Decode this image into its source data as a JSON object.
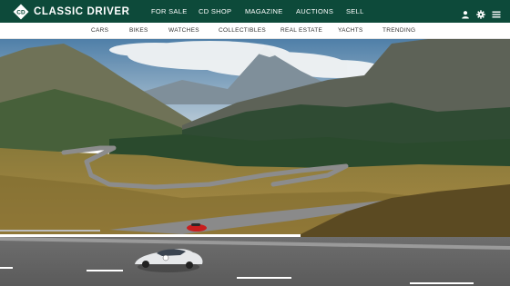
{
  "brand": {
    "name": "CLASSIC DRIVER",
    "monogram": "CD"
  },
  "main_nav": [
    {
      "label": "FOR SALE"
    },
    {
      "label": "CD SHOP"
    },
    {
      "label": "MAGAZINE"
    },
    {
      "label": "AUCTIONS"
    },
    {
      "label": "SELL"
    }
  ],
  "nav_icons": [
    "user-icon",
    "gear-icon",
    "menu-icon"
  ],
  "category_nav": [
    {
      "label": "CARS"
    },
    {
      "label": "BIKES"
    },
    {
      "label": "WATCHES"
    },
    {
      "label": "COLLECTIBLES"
    },
    {
      "label": "REAL ESTATE"
    },
    {
      "label": "YACHTS"
    },
    {
      "label": "TRENDING"
    }
  ],
  "hero": {
    "subject": "Mountain pass road with classic cars"
  },
  "colors": {
    "header_bg": "#0d4a3a",
    "header_text": "#ffffff",
    "subnav_text": "#333333"
  }
}
